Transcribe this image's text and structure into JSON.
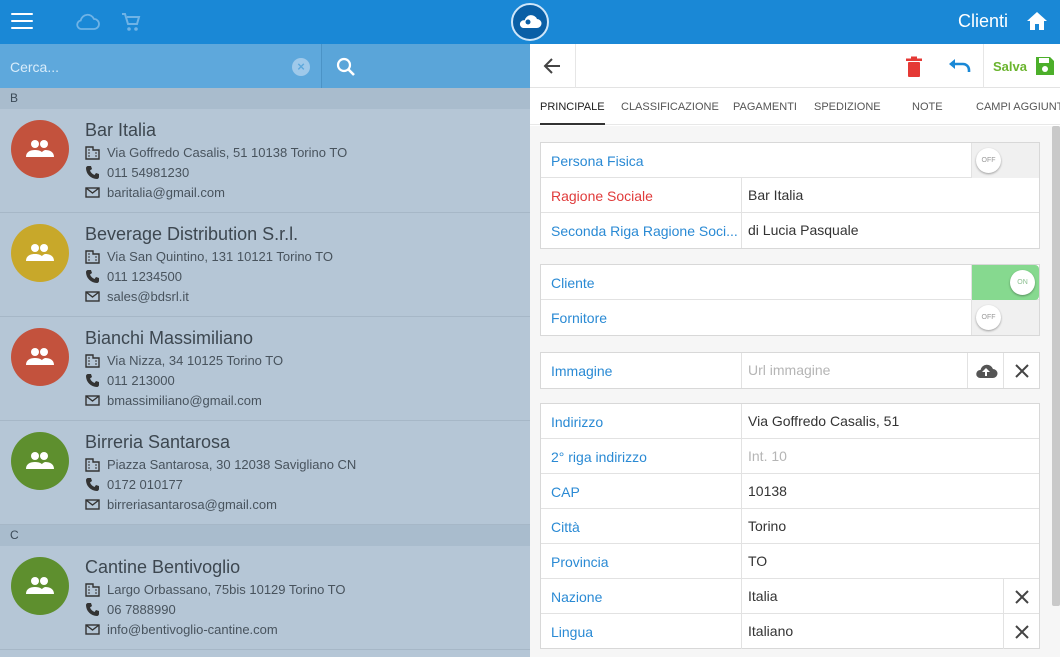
{
  "header": {
    "title": "Clienti"
  },
  "search": {
    "placeholder": "Cerca..."
  },
  "list": {
    "section_b": "B",
    "section_c": "C",
    "contacts": [
      {
        "name": "Bar Italia",
        "address": "Via Goffredo Casalis, 51 10138 Torino TO",
        "phone": "011 54981230",
        "email": "baritalia@gmail.com",
        "color": "#c3523d"
      },
      {
        "name": "Beverage Distribution S.r.l.",
        "address": "Via San Quintino, 131 10121 Torino TO",
        "phone": "011 1234500",
        "email": "sales@bdsrl.it",
        "color": "#c8a82a"
      },
      {
        "name": "Bianchi Massimiliano",
        "address": "Via Nizza, 34 10125 Torino TO",
        "phone": "011 213000",
        "email": "bmassimiliano@gmail.com",
        "color": "#c3523d"
      },
      {
        "name": "Birreria Santarosa",
        "address": "Piazza Santarosa, 30 12038 Savigliano CN",
        "phone": "0172 010177",
        "email": "birreriasantarosa@gmail.com",
        "color": "#5e8f2e"
      },
      {
        "name": "Cantine Bentivoglio",
        "address": "Largo Orbassano, 75bis 10129 Torino TO",
        "phone": "06 7888990",
        "email": "info@bentivoglio-cantine.com",
        "color": "#5e8f2e"
      }
    ]
  },
  "detail": {
    "save_label": "Salva",
    "tabs": [
      "PRINCIPALE",
      "CLASSIFICAZIONE",
      "PAGAMENTI",
      "SPEDIZIONE",
      "NOTE",
      "CAMPI AGGIUNT"
    ],
    "persona_fisica": {
      "label": "Persona Fisica",
      "state": "OFF"
    },
    "ragione_sociale": {
      "label": "Ragione Sociale",
      "value": "Bar Italia"
    },
    "seconda_riga": {
      "label": "Seconda Riga Ragione Soci...",
      "value": "di Lucia Pasquale"
    },
    "cliente": {
      "label": "Cliente",
      "state": "ON"
    },
    "fornitore": {
      "label": "Fornitore",
      "state": "OFF"
    },
    "immagine": {
      "label": "Immagine",
      "placeholder": "Url immagine"
    },
    "indirizzo": {
      "label": "Indirizzo",
      "value": "Via Goffredo Casalis, 51"
    },
    "riga2": {
      "label": "2° riga indirizzo",
      "placeholder": "Int. 10"
    },
    "cap": {
      "label": "CAP",
      "value": "10138"
    },
    "citta": {
      "label": "Città",
      "value": "Torino"
    },
    "provincia": {
      "label": "Provincia",
      "value": "TO"
    },
    "nazione": {
      "label": "Nazione",
      "value": "Italia"
    },
    "lingua": {
      "label": "Lingua",
      "value": "Italiano"
    }
  }
}
